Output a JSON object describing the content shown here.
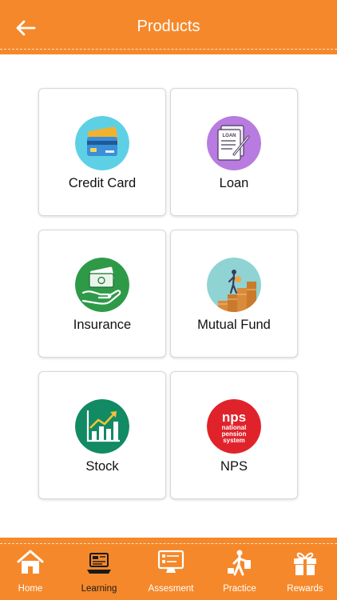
{
  "header": {
    "title": "Products"
  },
  "products": [
    {
      "label": "Credit Card"
    },
    {
      "label": "Loan",
      "icon_text": "LOAN"
    },
    {
      "label": "Insurance"
    },
    {
      "label": "Mutual Fund"
    },
    {
      "label": "Stock"
    },
    {
      "label": "NPS",
      "icon_text": [
        "nps",
        "national",
        "pension",
        "system"
      ]
    }
  ],
  "tabs": [
    {
      "label": "Home"
    },
    {
      "label": "Learning",
      "active": true
    },
    {
      "label": "Assesment"
    },
    {
      "label": "Practice"
    },
    {
      "label": "Rewards"
    }
  ],
  "colors": {
    "header": "#f5882a",
    "bottom_bar": "#f5882a",
    "credit_card_icon_bg": "#5ed0e6",
    "loan_icon_bg": "#b87be0",
    "insurance_icon_bg": "#2e9a48",
    "mutual_fund_icon_bg": "#8fd3d4",
    "stock_icon_bg": "#128a63",
    "nps_icon_bg": "#e0232b"
  }
}
